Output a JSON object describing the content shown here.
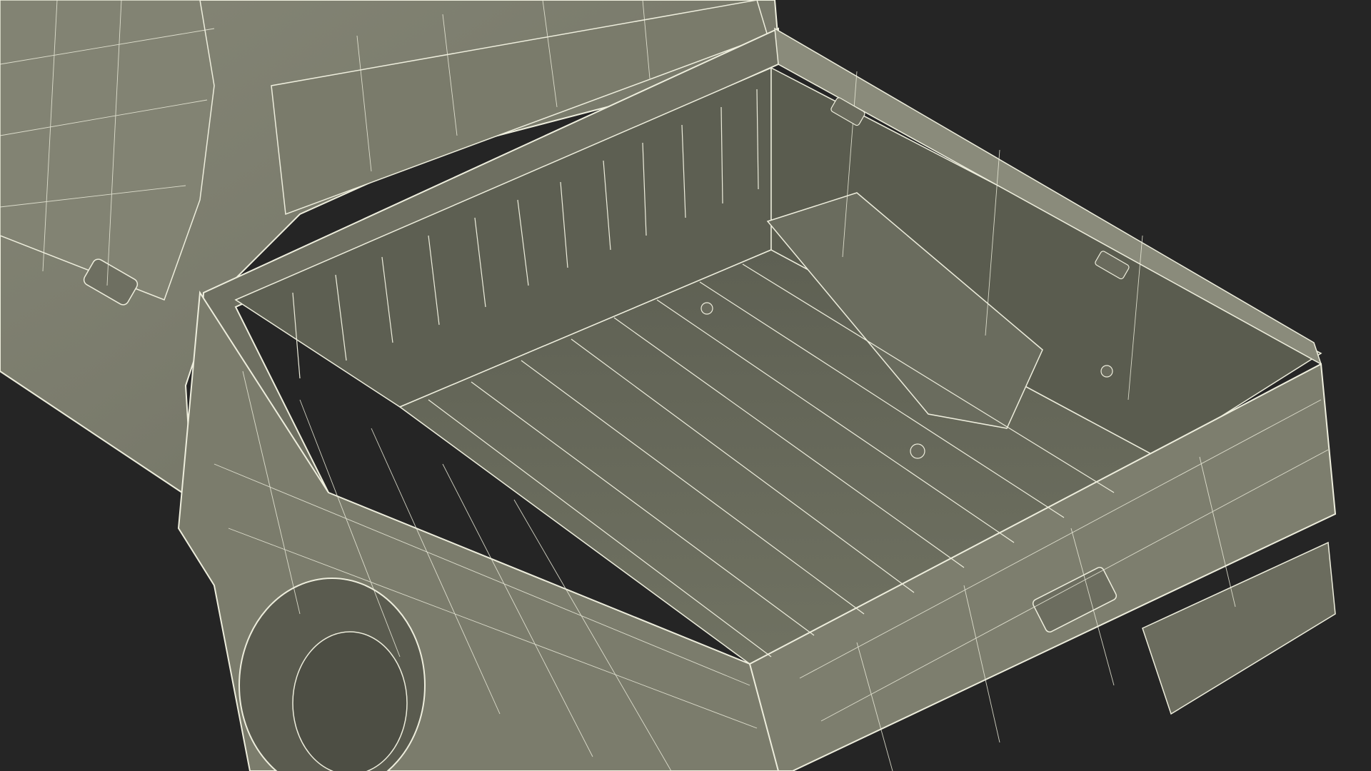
{
  "scene": {
    "subject": "pickup-truck-bed-wireframe",
    "render_mode": "wireframe-on-shaded",
    "text_labels": []
  },
  "colors": {
    "background": "#252525",
    "body_surface": "#7c7d6d",
    "bed_floor": "#676a5a",
    "bed_wall": "#5c5e50",
    "shadow": "#4a4c40",
    "tire": "#5a5b4f",
    "wire": "#eeeedd"
  }
}
